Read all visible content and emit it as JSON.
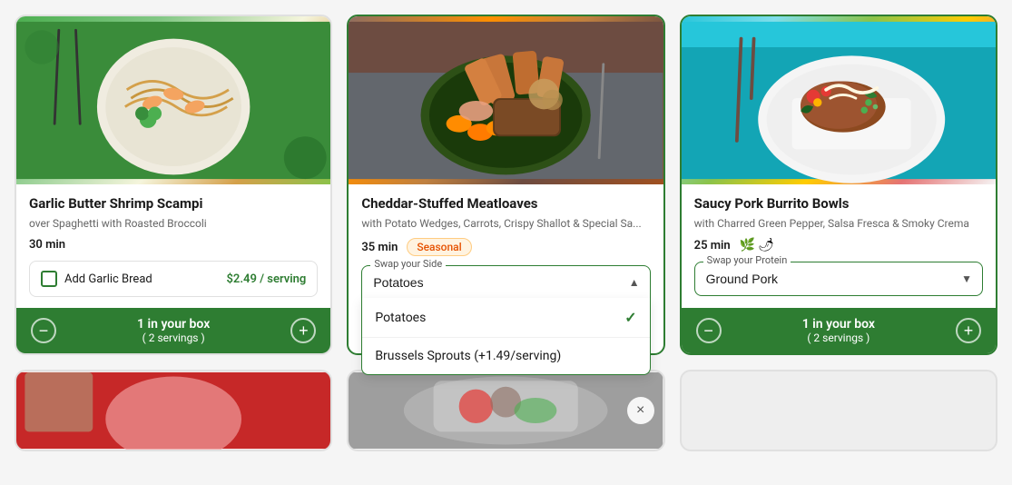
{
  "cards": [
    {
      "id": "shrimp-scampi",
      "title": "Garlic Butter Shrimp Scampi",
      "subtitle": "over Spaghetti with Roasted Broccoli",
      "time": "30 min",
      "badge": null,
      "spice": [],
      "addon": {
        "label": "Add Garlic Bread",
        "price": "$2.49 / serving"
      },
      "swap": null,
      "footer": {
        "count": "1 in your box",
        "servings": "( 2 servings )"
      },
      "imageBg": "shrimp",
      "borderActive": false
    },
    {
      "id": "cheddar-meatloaves",
      "title": "Cheddar-Stuffed Meatloaves",
      "subtitle": "with Potato Wedges, Carrots, Crispy Shallot & Special Sa...",
      "time": "35 min",
      "badge": "Seasonal",
      "spice": [],
      "addon": null,
      "swap": {
        "label": "Swap your Side",
        "selected": "Potatoes",
        "open": true,
        "options": [
          {
            "value": "Potatoes",
            "label": "Potatoes",
            "checked": true,
            "extra": null
          },
          {
            "value": "Brussels Sprouts",
            "label": "Brussels Sprouts (+1.49/serving)",
            "checked": false,
            "extra": "+1.49/serving"
          }
        ]
      },
      "footer": null,
      "imageBg": "meatloaf",
      "borderActive": true
    },
    {
      "id": "pork-burrito",
      "title": "Saucy Pork Burrito Bowls",
      "subtitle": "with Charred Green Pepper, Salsa Fresca & Smoky Crema",
      "time": "25 min",
      "badge": null,
      "spice": [
        "🌿",
        "🌶"
      ],
      "addon": null,
      "swap": {
        "label": "Swap your Protein",
        "selected": "Ground Pork",
        "open": false,
        "options": [
          {
            "value": "Ground Pork",
            "label": "Ground Pork",
            "checked": true,
            "extra": null
          }
        ]
      },
      "footer": {
        "count": "1 in your box",
        "servings": "( 2 servings )"
      },
      "imageBg": "burrito",
      "borderActive": true
    }
  ],
  "bottom_cards": [
    {
      "id": "thai",
      "imageBg": "thai",
      "hasClose": false
    },
    {
      "id": "veggie",
      "imageBg": "veggie",
      "hasClose": true
    },
    {
      "id": "empty",
      "imageBg": null,
      "hasClose": false
    }
  ],
  "icons": {
    "minus": "−",
    "plus": "+",
    "check": "✓",
    "close": "×",
    "chevron_up": "▲",
    "chevron_down": "▼"
  }
}
